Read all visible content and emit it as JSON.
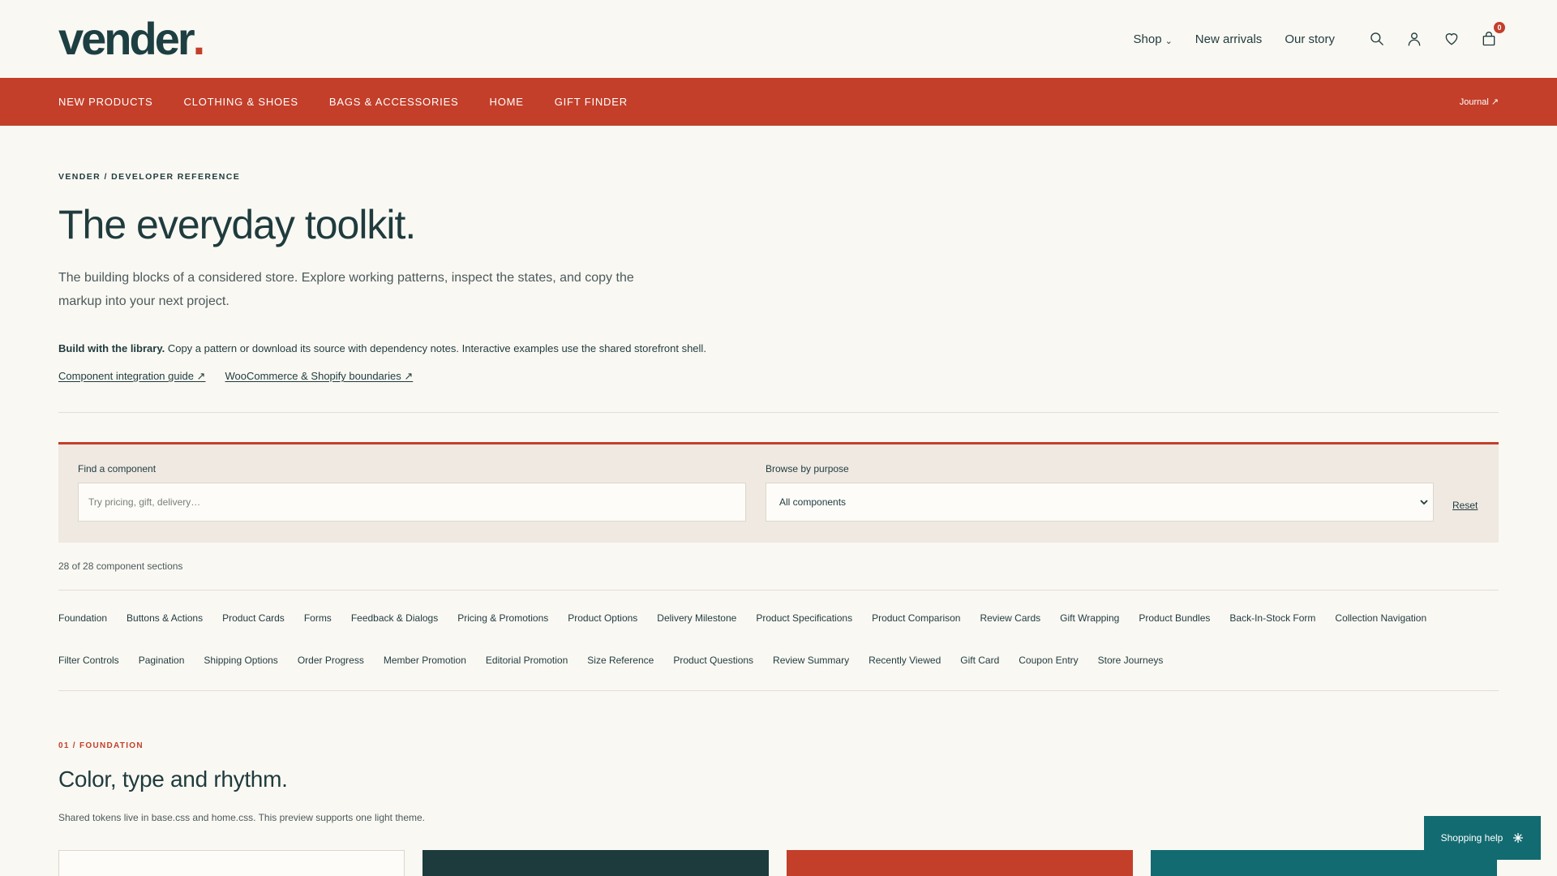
{
  "brand": {
    "logo_text": "vender",
    "logo_dot": "."
  },
  "top_nav": [
    {
      "label": "Shop",
      "has_chevron": true
    },
    {
      "label": "New arrivals",
      "has_chevron": false
    },
    {
      "label": "Our story",
      "has_chevron": false
    }
  ],
  "header_icons": [
    "search-icon",
    "account-icon",
    "heart-icon",
    "bag-icon"
  ],
  "cart": {
    "count": "0"
  },
  "category_bar": {
    "items": [
      "NEW PRODUCTS",
      "CLOTHING & SHOES",
      "BAGS & ACCESSORIES",
      "HOME",
      "GIFT FINDER"
    ],
    "journal_label": "Journal",
    "journal_arrow": "↗"
  },
  "hero": {
    "eyebrow": "VENDER / DEVELOPER REFERENCE",
    "title": "The everyday toolkit.",
    "description": "The building blocks of a considered store. Explore working patterns, inspect the states, and copy the markup into your next project."
  },
  "build": {
    "bold": "Build with the library.",
    "text": " Copy a pattern or download its source with dependency notes. Interactive examples use the shared storefront shell."
  },
  "links": [
    {
      "label": "Component integration guide ↗"
    },
    {
      "label": "WooCommerce & Shopify boundaries ↗"
    }
  ],
  "filter": {
    "search_label": "Find a component",
    "search_placeholder": "Try pricing, gift, delivery…",
    "browse_label": "Browse by purpose",
    "browse_value": "All components",
    "reset_label": "Reset"
  },
  "count_text": "28 of 28 component sections",
  "components": [
    "Foundation",
    "Buttons & Actions",
    "Product Cards",
    "Forms",
    "Feedback & Dialogs",
    "Pricing & Promotions",
    "Product Options",
    "Delivery Milestone",
    "Product Specifications",
    "Product Comparison",
    "Review Cards",
    "Gift Wrapping",
    "Product Bundles",
    "Back-In-Stock Form",
    "Collection Navigation",
    "Filter Controls",
    "Pagination",
    "Shipping Options",
    "Order Progress",
    "Member Promotion",
    "Editorial Promotion",
    "Size Reference",
    "Product Questions",
    "Review Summary",
    "Recently Viewed",
    "Gift Card",
    "Coupon Entry",
    "Store Journeys"
  ],
  "section": {
    "eyebrow": "01 / FOUNDATION",
    "title": "Color, type and rhythm.",
    "description": "Shared tokens live in base.css and home.css. This preview supports one light theme."
  },
  "swatches": [
    "#fdfcf8",
    "#1d3a3c",
    "#c33f2a",
    "#126b70"
  ],
  "help": {
    "label": "Shopping help",
    "icon": "sparkle-icon"
  },
  "colors": {
    "accent": "#c33f2a",
    "ink": "#1f3b3d",
    "teal": "#126b70"
  }
}
